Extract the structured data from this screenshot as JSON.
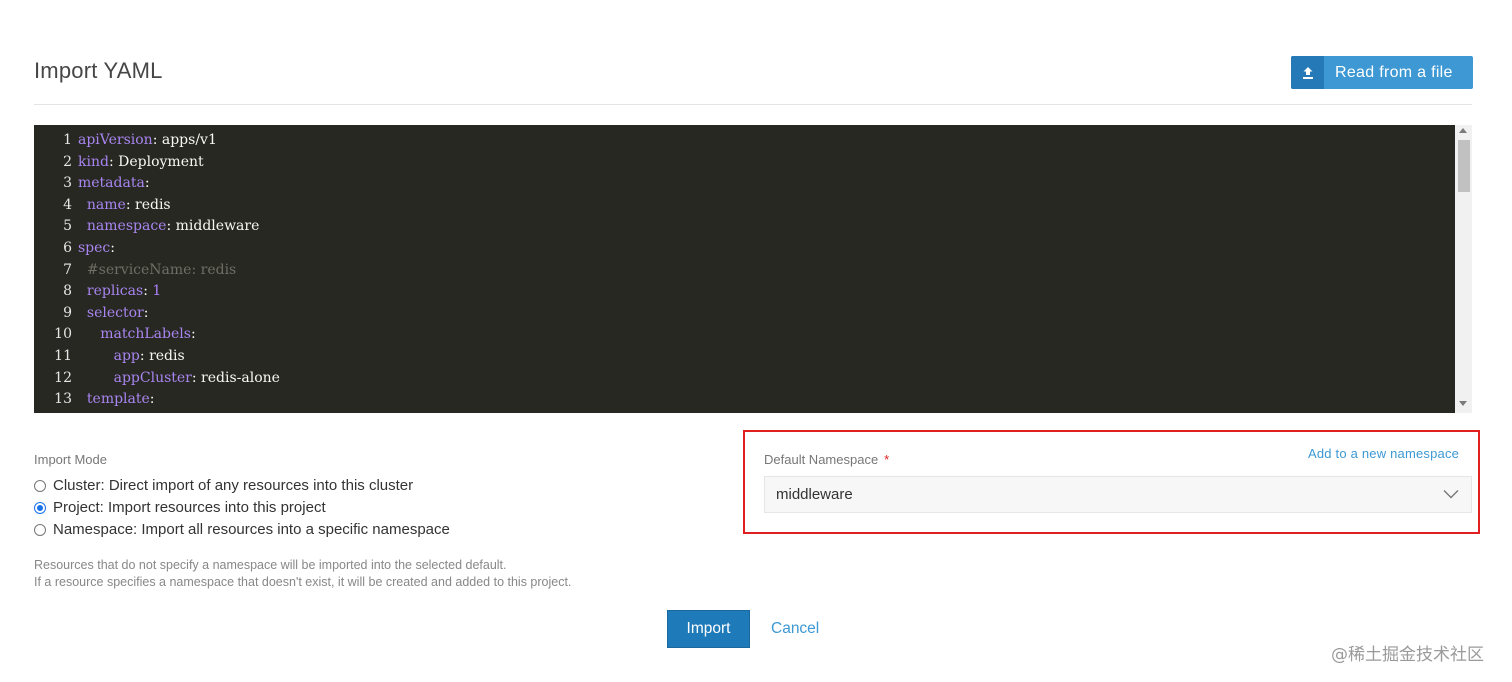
{
  "header": {
    "title": "Import YAML",
    "read_button_label": "Read from a file",
    "read_button_icon": "upload-icon"
  },
  "editor": {
    "lines": [
      {
        "no": "1",
        "indent": "",
        "key": "apiVersion",
        "sep": ": ",
        "value": "apps/v1",
        "vtype": "v"
      },
      {
        "no": "2",
        "indent": "",
        "key": "kind",
        "sep": ": ",
        "value": "Deployment",
        "vtype": "v"
      },
      {
        "no": "3",
        "indent": "",
        "key": "metadata",
        "sep": ":",
        "value": "",
        "vtype": "v"
      },
      {
        "no": "4",
        "indent": "  ",
        "key": "name",
        "sep": ": ",
        "value": "redis",
        "vtype": "v"
      },
      {
        "no": "5",
        "indent": "  ",
        "key": "namespace",
        "sep": ": ",
        "value": "middleware",
        "vtype": "v"
      },
      {
        "no": "6",
        "indent": "",
        "key": "spec",
        "sep": ":",
        "value": "",
        "vtype": "v"
      },
      {
        "no": "7",
        "indent": "  ",
        "key": "",
        "sep": "",
        "value": "#serviceName: redis",
        "vtype": "c"
      },
      {
        "no": "8",
        "indent": "  ",
        "key": "replicas",
        "sep": ": ",
        "value": "1",
        "vtype": "n"
      },
      {
        "no": "9",
        "indent": "  ",
        "key": "selector",
        "sep": ":",
        "value": "",
        "vtype": "v"
      },
      {
        "no": "10",
        "indent": "     ",
        "key": "matchLabels",
        "sep": ":",
        "value": "",
        "vtype": "v"
      },
      {
        "no": "11",
        "indent": "        ",
        "key": "app",
        "sep": ": ",
        "value": "redis",
        "vtype": "v"
      },
      {
        "no": "12",
        "indent": "        ",
        "key": "appCluster",
        "sep": ": ",
        "value": "redis-alone",
        "vtype": "v"
      },
      {
        "no": "13",
        "indent": "  ",
        "key": "template",
        "sep": ":",
        "value": "",
        "vtype": "v"
      }
    ]
  },
  "import_mode": {
    "label": "Import Mode",
    "options": [
      {
        "label": "Cluster: Direct import of any resources into this cluster",
        "checked": false
      },
      {
        "label": "Project: Import resources into this project",
        "checked": true
      },
      {
        "label": "Namespace: Import all resources into a specific namespace",
        "checked": false
      }
    ],
    "hint_line1": "Resources that do not specify a namespace will be imported into the selected default.",
    "hint_line2": "If a resource specifies a namespace that doesn't exist, it will be created and added to this project."
  },
  "namespace": {
    "label": "Default Namespace",
    "required_mark": "*",
    "add_link": "Add to a new namespace",
    "selected": "middleware"
  },
  "actions": {
    "import_label": "Import",
    "cancel_label": "Cancel"
  },
  "watermark": "@稀土掘金技术社区",
  "colors": {
    "accent": "#3d98d3",
    "primary_button": "#1e7ab8",
    "editor_bg": "#272822",
    "highlight_border": "#e02020"
  }
}
